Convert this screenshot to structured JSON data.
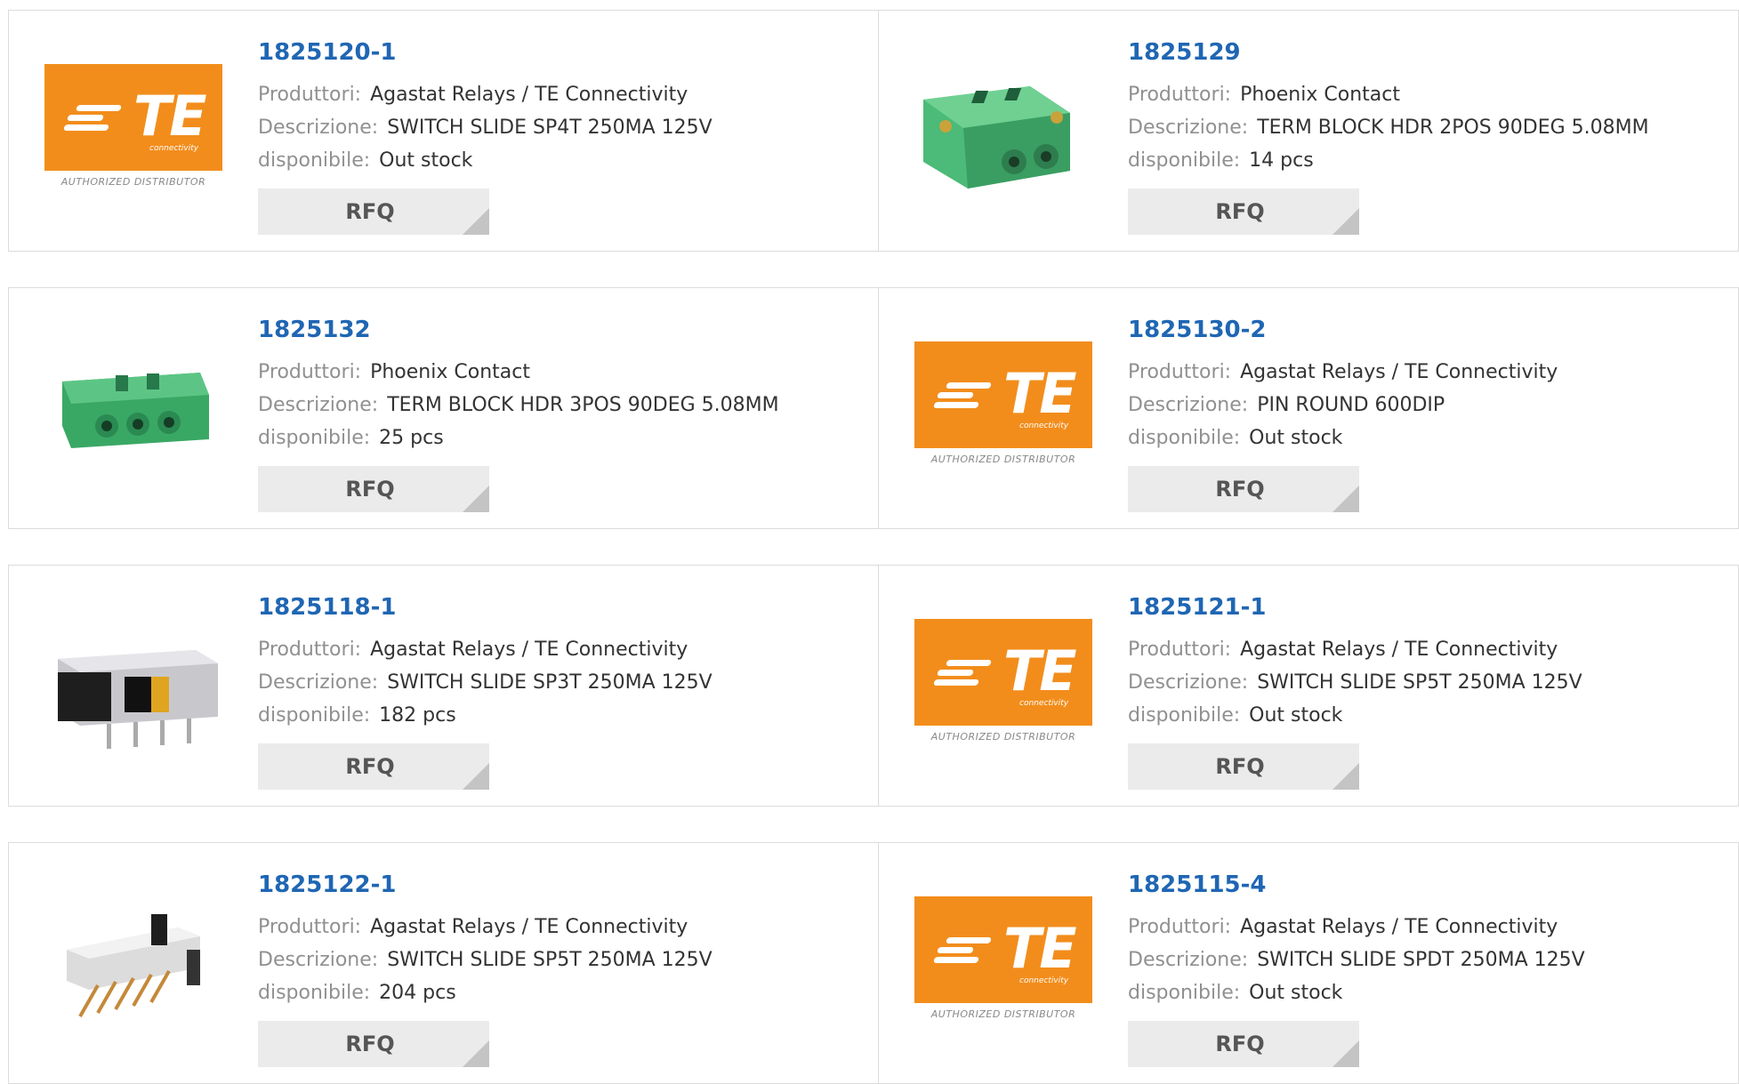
{
  "labels": {
    "manufacturer": "Produttori:",
    "description": "Descrizione:",
    "availability": "disponibile:",
    "rfq": "RFQ"
  },
  "logo": {
    "brand": "TE",
    "sub": "connectivity",
    "authorized": "AUTHORIZED DISTRIBUTOR",
    "color": "#f28d1c"
  },
  "products": [
    {
      "part": "1825120-1",
      "manufacturer": "Agastat Relays / TE Connectivity",
      "description": "SWITCH SLIDE SP4T 250MA 125V",
      "availability": "Out stock",
      "image": "te-logo"
    },
    {
      "part": "1825129",
      "manufacturer": "Phoenix Contact",
      "description": "TERM BLOCK HDR 2POS 90DEG 5.08MM",
      "availability": "14 pcs",
      "image": "green-terminal-2pos"
    },
    {
      "part": "1825132",
      "manufacturer": "Phoenix Contact",
      "description": "TERM BLOCK HDR 3POS 90DEG 5.08MM",
      "availability": "25 pcs",
      "image": "green-terminal-3pos"
    },
    {
      "part": "1825130-2",
      "manufacturer": "Agastat Relays / TE Connectivity",
      "description": "PIN ROUND 600DIP",
      "availability": "Out stock",
      "image": "te-logo"
    },
    {
      "part": "1825118-1",
      "manufacturer": "Agastat Relays / TE Connectivity",
      "description": "SWITCH SLIDE SP3T 250MA 125V",
      "availability": "182 pcs",
      "image": "slide-switch-black"
    },
    {
      "part": "1825121-1",
      "manufacturer": "Agastat Relays / TE Connectivity",
      "description": "SWITCH SLIDE SP5T 250MA 125V",
      "availability": "Out stock",
      "image": "te-logo"
    },
    {
      "part": "1825122-1",
      "manufacturer": "Agastat Relays / TE Connectivity",
      "description": "SWITCH SLIDE SP5T 250MA 125V",
      "availability": "204 pcs",
      "image": "slide-switch-white"
    },
    {
      "part": "1825115-4",
      "manufacturer": "Agastat Relays / TE Connectivity",
      "description": "SWITCH SLIDE SPDT 250MA 125V",
      "availability": "Out stock",
      "image": "te-logo"
    }
  ]
}
